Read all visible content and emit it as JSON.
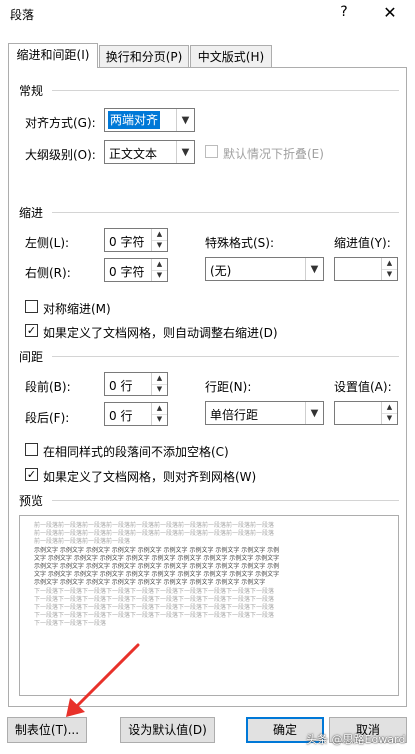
{
  "window": {
    "title": "段落",
    "help_label": "?",
    "close_label": "✕"
  },
  "tabs": [
    {
      "label": "缩进和间距(I)"
    },
    {
      "label": "换行和分页(P)"
    },
    {
      "label": "中文版式(H)"
    }
  ],
  "general": {
    "title": "常规",
    "alignment_label": "对齐方式(G):",
    "alignment_value": "两端对齐",
    "outline_label": "大纲级别(O):",
    "outline_value": "正文文本",
    "collapse_label": "默认情况下折叠(E)"
  },
  "indent": {
    "title": "缩进",
    "left_label": "左侧(L):",
    "left_value": "0 字符",
    "right_label": "右侧(R):",
    "right_value": "0 字符",
    "special_label": "特殊格式(S):",
    "special_value": "(无)",
    "by_label": "缩进值(Y):",
    "by_value": "",
    "mirror_label": "对称缩进(M)",
    "auto_adjust_label": "如果定义了文档网格，则自动调整右缩进(D)"
  },
  "spacing": {
    "title": "间距",
    "before_label": "段前(B):",
    "before_value": "0 行",
    "after_label": "段后(F):",
    "after_value": "0 行",
    "line_label": "行距(N):",
    "line_value": "单倍行距",
    "at_label": "设置值(A):",
    "at_value": "",
    "no_space_label": "在相同样式的段落间不添加空格(C)",
    "snap_grid_label": "如果定义了文档网格，则对齐到网格(W)"
  },
  "preview": {
    "title": "预览",
    "prev_lines": [
      "前一段落前一段落前一段落前一段落前一段落前一段落前一段落前一段落前一段落前一段落",
      "前一段落前一段落前一段落前一段落前一段落前一段落前一段落前一段落前一段落前一段落",
      "前一段落前一段落前一段落前一段落"
    ],
    "sample_lines": [
      "示例文字 示例文字 示例文字 示例文字 示例文字 示例文字 示例文字 示例文字 示例文字 示例",
      "文字 示例文字 示例文字 示例文字 示例文字 示例文字 示例文字 示例文字 示例文字 示例文字",
      "示例文字 示例文字 示例文字 示例文字 示例文字 示例文字 示例文字 示例文字 示例文字 示例",
      "文字 示例文字 示例文字 示例文字 示例文字 示例文字 示例文字 示例文字 示例文字 示例文字",
      "示例文字 示例文字 示例文字 示例文字 示例文字 示例文字 示例文字 示例文字 示例文字"
    ],
    "next_lines": [
      "下一段落下一段落下一段落下一段落下一段落下一段落下一段落下一段落下一段落下一段落",
      "下一段落下一段落下一段落下一段落下一段落下一段落下一段落下一段落下一段落下一段落",
      "下一段落下一段落下一段落下一段落下一段落下一段落下一段落下一段落下一段落下一段落",
      "下一段落下一段落下一段落下一段落下一段落下一段落下一段落下一段落下一段落下一段落",
      "下一段落下一段落下一段落"
    ]
  },
  "buttons": {
    "tabs_label": "制表位(T)...",
    "default_label": "设为默认值(D)",
    "ok_label": "确定",
    "cancel_label": "取消"
  },
  "watermark": "头条 @思路Edward",
  "colors": {
    "selection": "#0078d7",
    "annotation_arrow": "#e8312a"
  }
}
